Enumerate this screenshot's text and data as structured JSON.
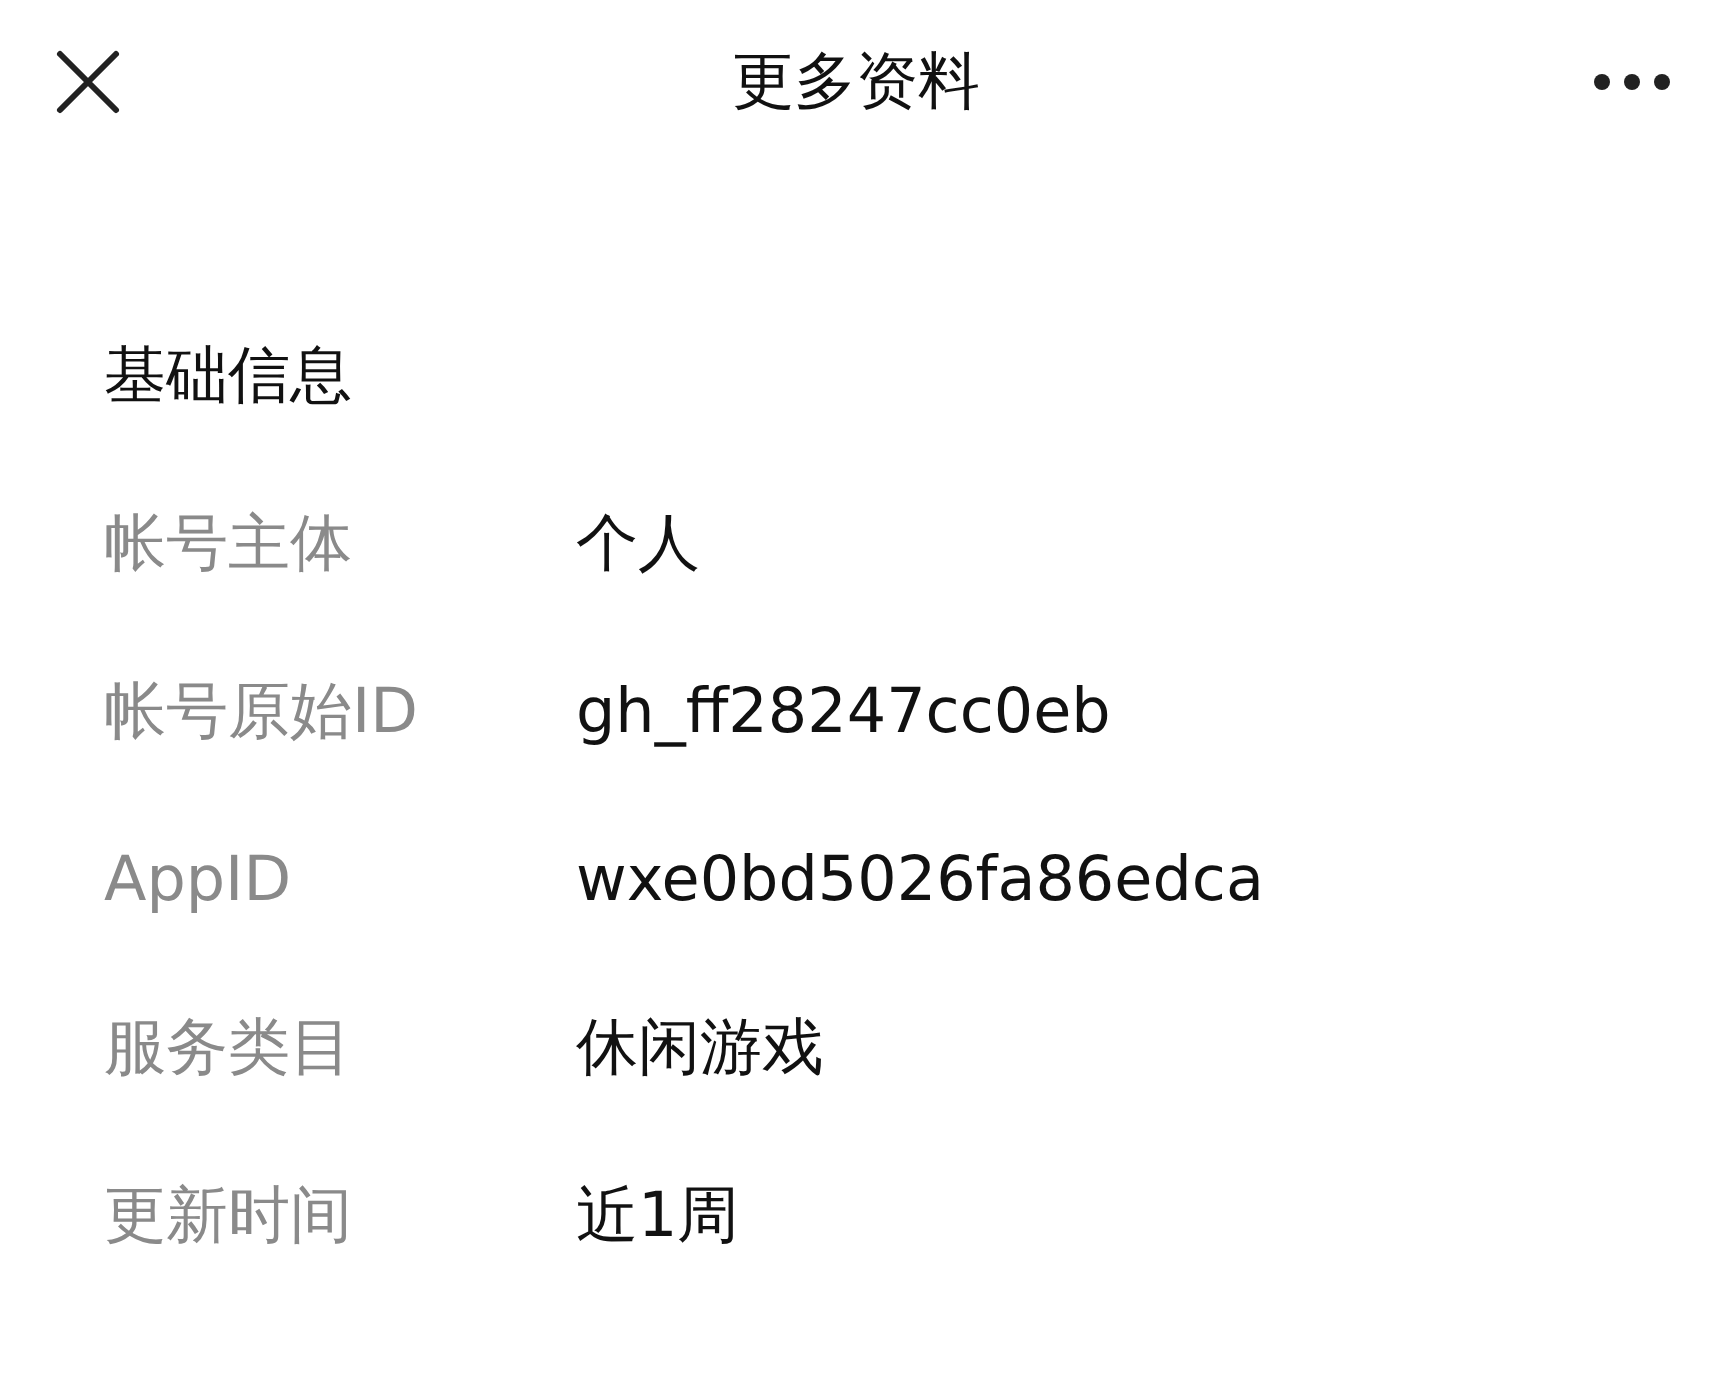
{
  "header": {
    "title": "更多资料"
  },
  "section": {
    "title": "基础信息"
  },
  "rows": [
    {
      "label": "帐号主体",
      "value": "个人"
    },
    {
      "label": "帐号原始ID",
      "value": "gh_ff28247cc0eb"
    },
    {
      "label": "AppID",
      "value": "wxe0bd5026fa86edca"
    },
    {
      "label": "服务类目",
      "value": "休闲游戏"
    },
    {
      "label": "更新时间",
      "value": "近1周"
    }
  ]
}
